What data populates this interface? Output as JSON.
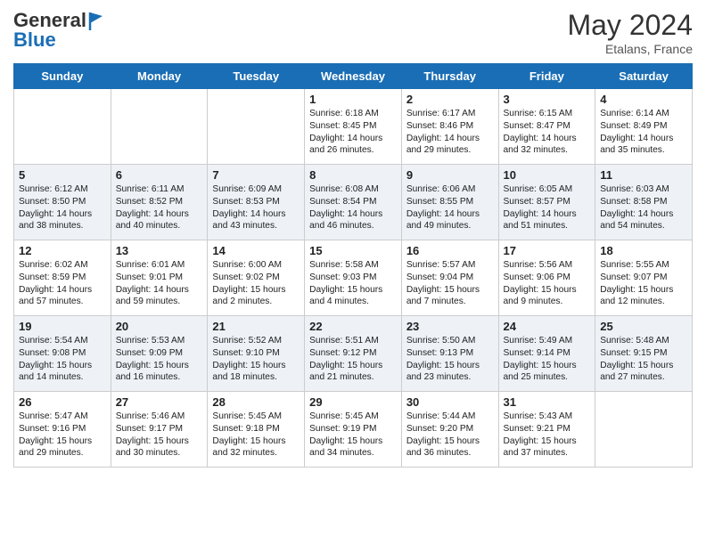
{
  "header": {
    "logo_line1": "General",
    "logo_line2": "Blue",
    "month_year": "May 2024",
    "location": "Etalans, France"
  },
  "weekdays": [
    "Sunday",
    "Monday",
    "Tuesday",
    "Wednesday",
    "Thursday",
    "Friday",
    "Saturday"
  ],
  "weeks": [
    [
      {
        "day": "",
        "info": ""
      },
      {
        "day": "",
        "info": ""
      },
      {
        "day": "",
        "info": ""
      },
      {
        "day": "1",
        "info": "Sunrise: 6:18 AM\nSunset: 8:45 PM\nDaylight: 14 hours\nand 26 minutes."
      },
      {
        "day": "2",
        "info": "Sunrise: 6:17 AM\nSunset: 8:46 PM\nDaylight: 14 hours\nand 29 minutes."
      },
      {
        "day": "3",
        "info": "Sunrise: 6:15 AM\nSunset: 8:47 PM\nDaylight: 14 hours\nand 32 minutes."
      },
      {
        "day": "4",
        "info": "Sunrise: 6:14 AM\nSunset: 8:49 PM\nDaylight: 14 hours\nand 35 minutes."
      }
    ],
    [
      {
        "day": "5",
        "info": "Sunrise: 6:12 AM\nSunset: 8:50 PM\nDaylight: 14 hours\nand 38 minutes."
      },
      {
        "day": "6",
        "info": "Sunrise: 6:11 AM\nSunset: 8:52 PM\nDaylight: 14 hours\nand 40 minutes."
      },
      {
        "day": "7",
        "info": "Sunrise: 6:09 AM\nSunset: 8:53 PM\nDaylight: 14 hours\nand 43 minutes."
      },
      {
        "day": "8",
        "info": "Sunrise: 6:08 AM\nSunset: 8:54 PM\nDaylight: 14 hours\nand 46 minutes."
      },
      {
        "day": "9",
        "info": "Sunrise: 6:06 AM\nSunset: 8:55 PM\nDaylight: 14 hours\nand 49 minutes."
      },
      {
        "day": "10",
        "info": "Sunrise: 6:05 AM\nSunset: 8:57 PM\nDaylight: 14 hours\nand 51 minutes."
      },
      {
        "day": "11",
        "info": "Sunrise: 6:03 AM\nSunset: 8:58 PM\nDaylight: 14 hours\nand 54 minutes."
      }
    ],
    [
      {
        "day": "12",
        "info": "Sunrise: 6:02 AM\nSunset: 8:59 PM\nDaylight: 14 hours\nand 57 minutes."
      },
      {
        "day": "13",
        "info": "Sunrise: 6:01 AM\nSunset: 9:01 PM\nDaylight: 14 hours\nand 59 minutes."
      },
      {
        "day": "14",
        "info": "Sunrise: 6:00 AM\nSunset: 9:02 PM\nDaylight: 15 hours\nand 2 minutes."
      },
      {
        "day": "15",
        "info": "Sunrise: 5:58 AM\nSunset: 9:03 PM\nDaylight: 15 hours\nand 4 minutes."
      },
      {
        "day": "16",
        "info": "Sunrise: 5:57 AM\nSunset: 9:04 PM\nDaylight: 15 hours\nand 7 minutes."
      },
      {
        "day": "17",
        "info": "Sunrise: 5:56 AM\nSunset: 9:06 PM\nDaylight: 15 hours\nand 9 minutes."
      },
      {
        "day": "18",
        "info": "Sunrise: 5:55 AM\nSunset: 9:07 PM\nDaylight: 15 hours\nand 12 minutes."
      }
    ],
    [
      {
        "day": "19",
        "info": "Sunrise: 5:54 AM\nSunset: 9:08 PM\nDaylight: 15 hours\nand 14 minutes."
      },
      {
        "day": "20",
        "info": "Sunrise: 5:53 AM\nSunset: 9:09 PM\nDaylight: 15 hours\nand 16 minutes."
      },
      {
        "day": "21",
        "info": "Sunrise: 5:52 AM\nSunset: 9:10 PM\nDaylight: 15 hours\nand 18 minutes."
      },
      {
        "day": "22",
        "info": "Sunrise: 5:51 AM\nSunset: 9:12 PM\nDaylight: 15 hours\nand 21 minutes."
      },
      {
        "day": "23",
        "info": "Sunrise: 5:50 AM\nSunset: 9:13 PM\nDaylight: 15 hours\nand 23 minutes."
      },
      {
        "day": "24",
        "info": "Sunrise: 5:49 AM\nSunset: 9:14 PM\nDaylight: 15 hours\nand 25 minutes."
      },
      {
        "day": "25",
        "info": "Sunrise: 5:48 AM\nSunset: 9:15 PM\nDaylight: 15 hours\nand 27 minutes."
      }
    ],
    [
      {
        "day": "26",
        "info": "Sunrise: 5:47 AM\nSunset: 9:16 PM\nDaylight: 15 hours\nand 29 minutes."
      },
      {
        "day": "27",
        "info": "Sunrise: 5:46 AM\nSunset: 9:17 PM\nDaylight: 15 hours\nand 30 minutes."
      },
      {
        "day": "28",
        "info": "Sunrise: 5:45 AM\nSunset: 9:18 PM\nDaylight: 15 hours\nand 32 minutes."
      },
      {
        "day": "29",
        "info": "Sunrise: 5:45 AM\nSunset: 9:19 PM\nDaylight: 15 hours\nand 34 minutes."
      },
      {
        "day": "30",
        "info": "Sunrise: 5:44 AM\nSunset: 9:20 PM\nDaylight: 15 hours\nand 36 minutes."
      },
      {
        "day": "31",
        "info": "Sunrise: 5:43 AM\nSunset: 9:21 PM\nDaylight: 15 hours\nand 37 minutes."
      },
      {
        "day": "",
        "info": ""
      }
    ]
  ]
}
